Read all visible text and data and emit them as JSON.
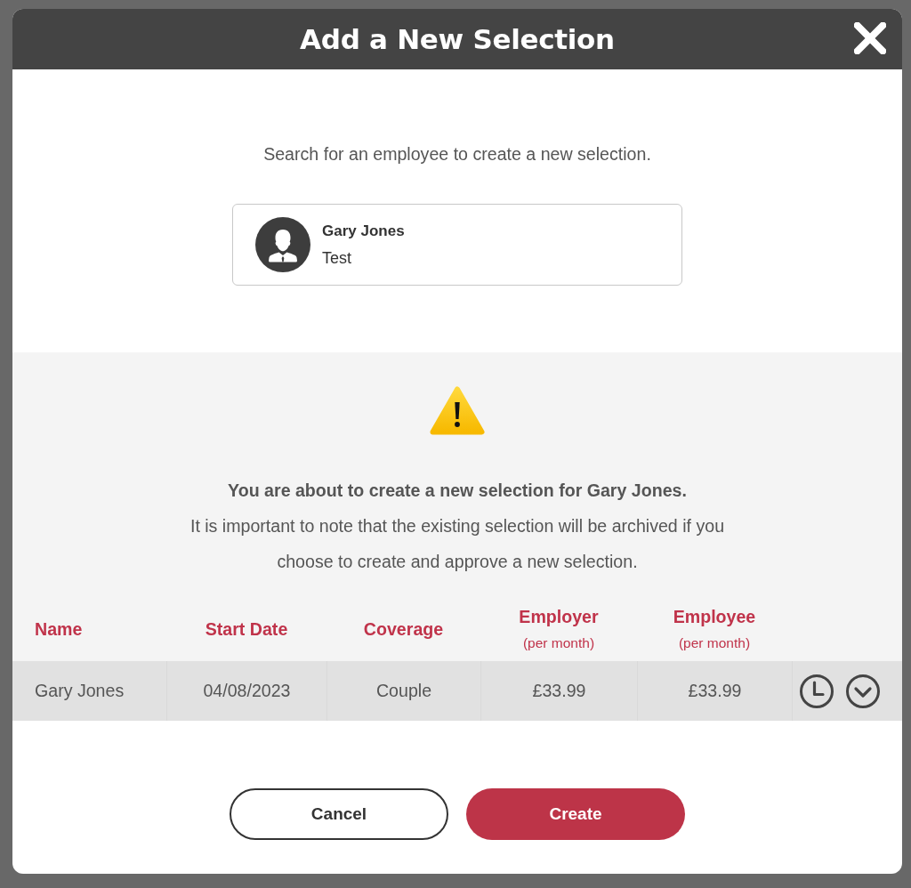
{
  "dialog": {
    "title": "Add a New Selection"
  },
  "search": {
    "prompt": "Search for an employee to create a new selection.",
    "result": {
      "name": "Gary Jones",
      "detail": "Test"
    }
  },
  "warning": {
    "heading": "You are about to create a new selection for Gary Jones.",
    "message": "It is important to note that the existing selection will be archived if you choose to create and approve a new selection."
  },
  "table": {
    "columns": [
      {
        "label": "Name"
      },
      {
        "label": "Start Date"
      },
      {
        "label": "Coverage"
      },
      {
        "label": "Employer",
        "note": "(per month)"
      },
      {
        "label": "Employee",
        "note": "(per month)"
      }
    ],
    "rows": [
      {
        "cells": [
          "Gary Jones",
          "04/08/2023",
          "Couple",
          "£33.99",
          "£33.99"
        ]
      }
    ]
  },
  "buttons": [
    {
      "label": "Cancel",
      "kind": "secondary"
    },
    {
      "label": "Create",
      "kind": "primary"
    }
  ]
}
